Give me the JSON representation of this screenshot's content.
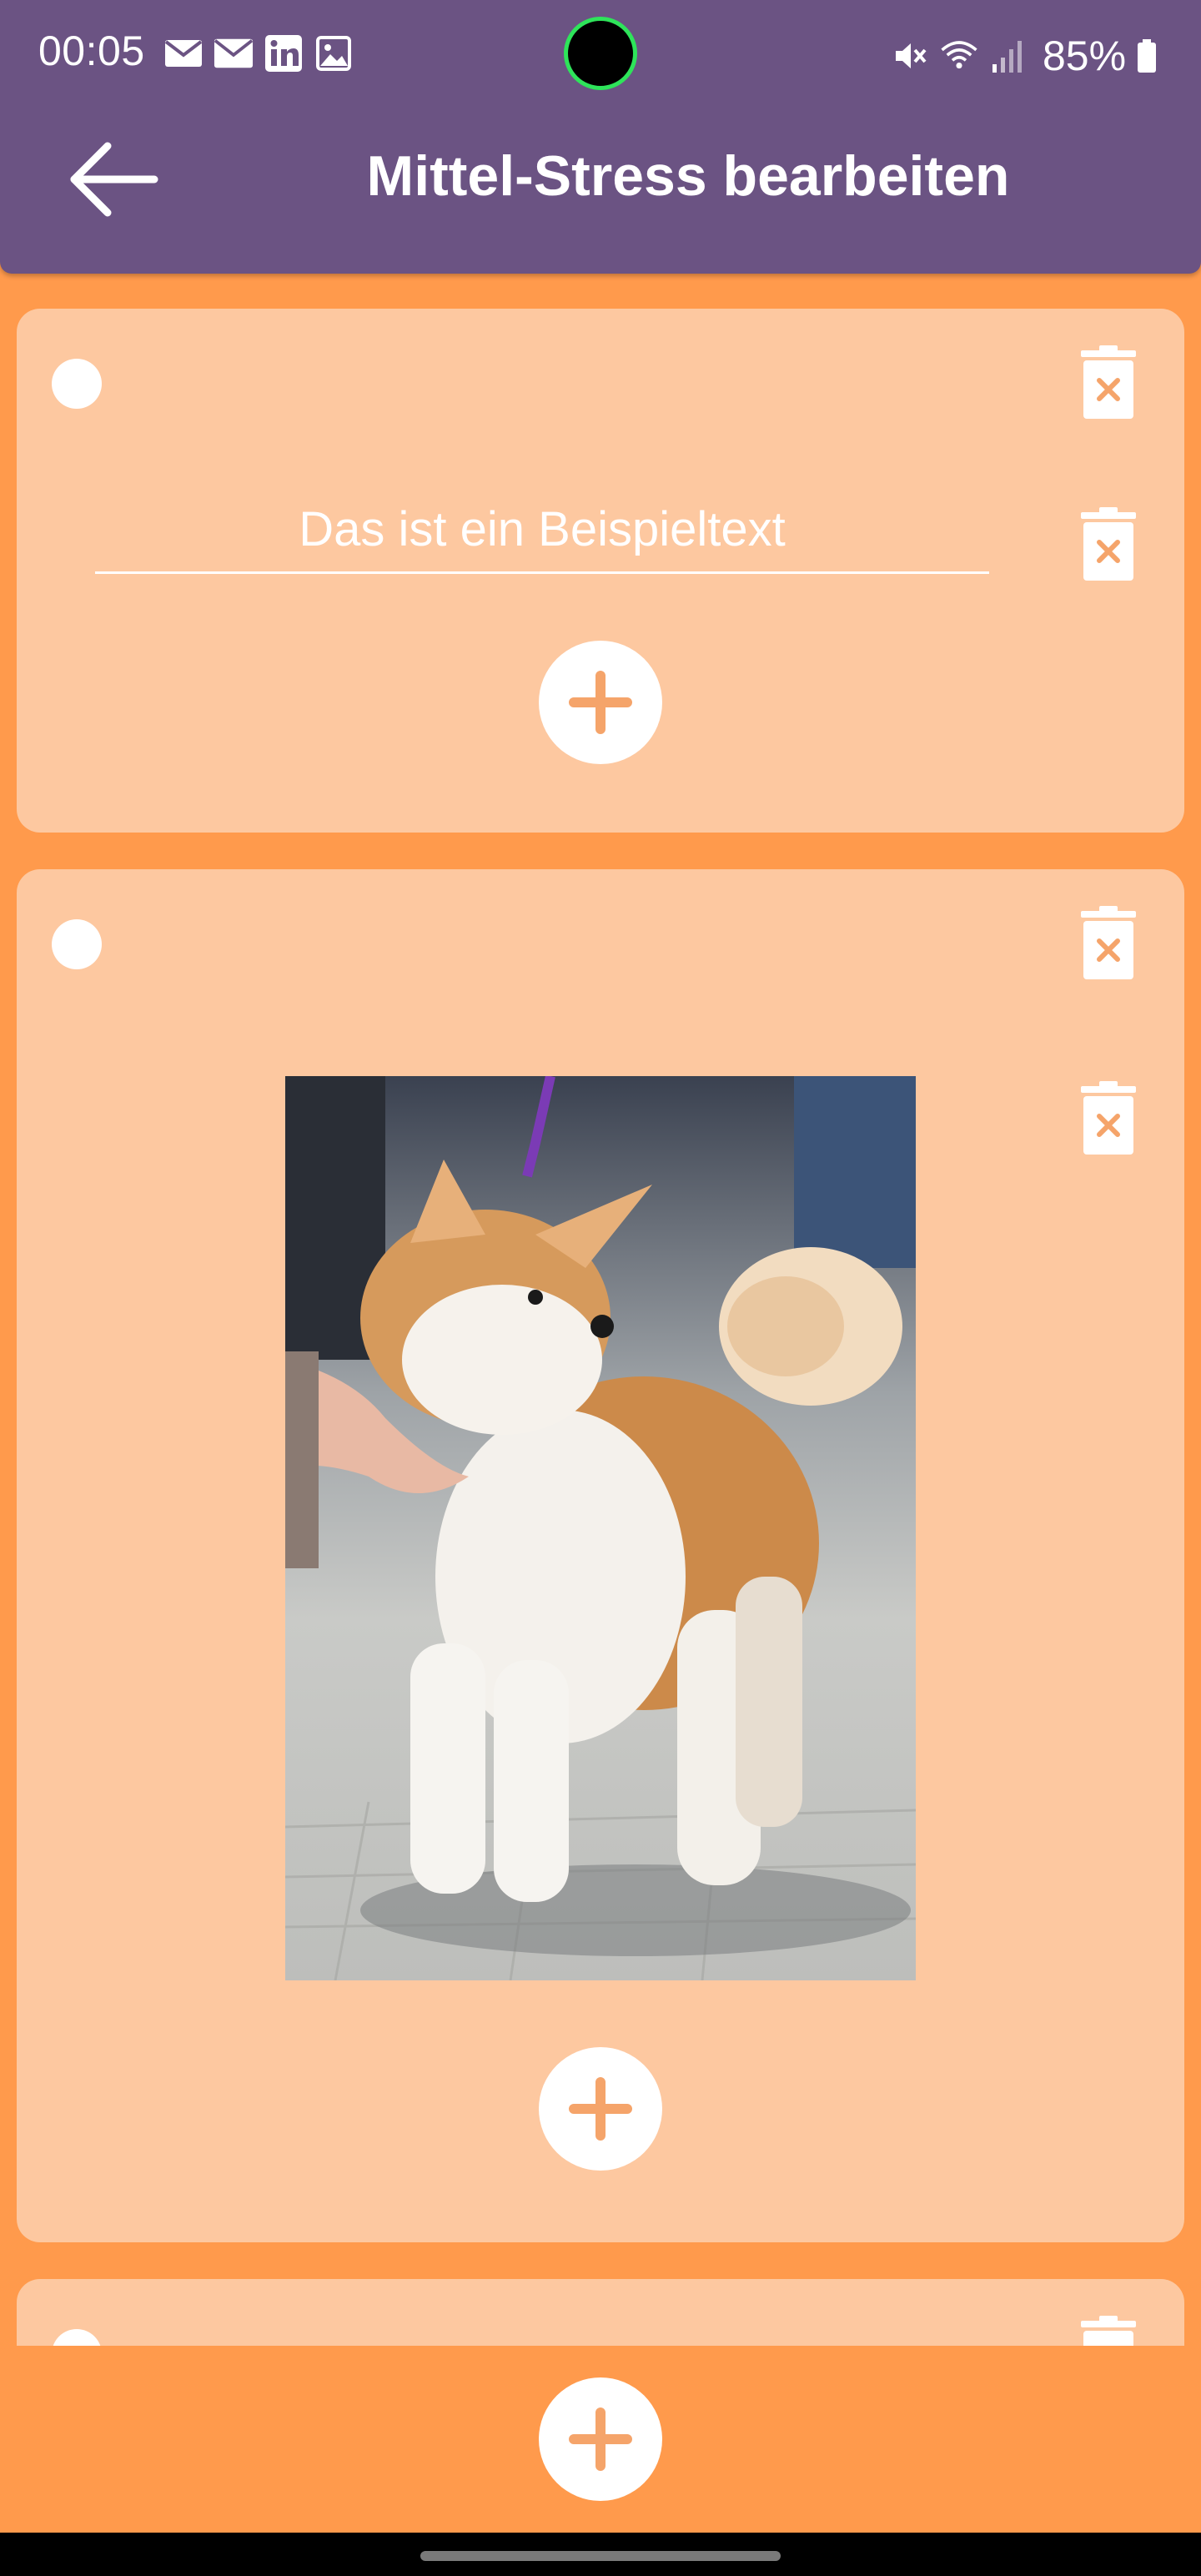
{
  "status_bar": {
    "time": "00:05",
    "battery_percent": "85%",
    "left_icons": [
      "mail-icon",
      "mail-icon",
      "linkedin-icon",
      "image-icon"
    ],
    "right_icons": [
      "mute-icon",
      "wifi-icon",
      "signal-icon",
      "battery-icon"
    ]
  },
  "app_bar": {
    "title": "Mittel-Stress bearbeiten",
    "back_icon": "arrow-left-icon"
  },
  "colors": {
    "app_bar": "#6b5383",
    "background": "#ff9a4c",
    "card": "#fdc8a0",
    "accent": "#f5a46a"
  },
  "cards": [
    {
      "type": "text",
      "text_value": "Das ist ein Beispieltext",
      "delete_icon": "trash-icon",
      "add_icon": "plus-icon"
    },
    {
      "type": "image",
      "image_subject": "Akita puppy standing on pavement",
      "delete_icon": "trash-icon",
      "add_icon": "plus-icon"
    },
    {
      "type": "partial"
    }
  ],
  "bottom": {
    "add_icon": "plus-icon"
  }
}
